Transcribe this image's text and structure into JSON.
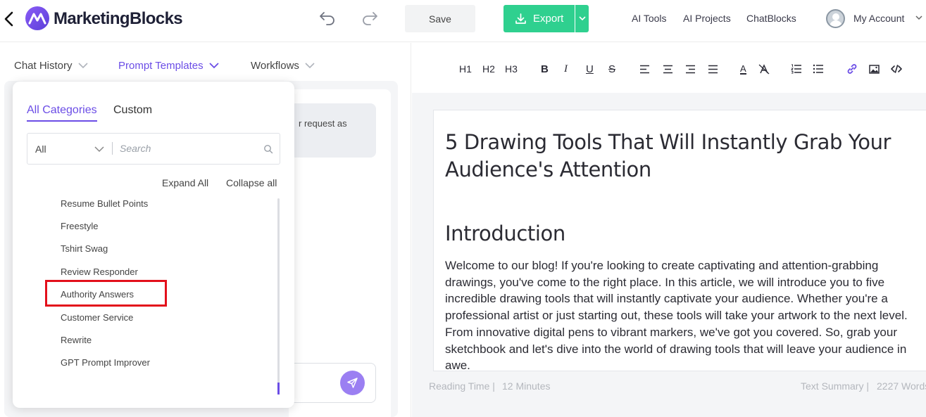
{
  "header": {
    "brand": "MarketingBlocks",
    "save_label": "Save",
    "export_label": "Export",
    "nav": [
      "AI Tools",
      "AI Projects",
      "ChatBlocks"
    ],
    "account_label": "My Account"
  },
  "left_tabs": [
    {
      "label": "Chat History",
      "active": false
    },
    {
      "label": "Prompt Templates",
      "active": true
    },
    {
      "label": "Workflows",
      "active": false
    }
  ],
  "chat": {
    "bubble_text": "r request as"
  },
  "prompt_dropdown": {
    "tabs": [
      {
        "label": "All Categories",
        "active": true
      },
      {
        "label": "Custom",
        "active": false
      }
    ],
    "category_value": "All",
    "search_placeholder": "Search",
    "expand_all": "Expand All",
    "collapse_all": "Collapse all",
    "items": [
      "Resume Bullet Points",
      "Freestyle",
      "Tshirt Swag",
      "Review Responder",
      "Authority Answers",
      "Customer Service",
      "Rewrite",
      "GPT Prompt Improver"
    ],
    "highlighted_item": "Authority Answers"
  },
  "editor": {
    "toolbar": {
      "h1": "H1",
      "h2": "H2",
      "h3": "H3",
      "bold": "B",
      "italic": "I",
      "underline": "U",
      "strike": "S",
      "font_color": "A"
    },
    "title": "5 Drawing Tools That Will Instantly Grab Your Audience's Attention",
    "heading": "Introduction",
    "body": "Welcome to our blog! If you're looking to create captivating and attention-grabbing drawings, you've come to the right place. In this article, we will introduce you to five incredible drawing tools that will instantly captivate your audience. Whether you're a professional artist or just starting out, these tools will take your artwork to the next level. From innovative digital pens to vibrant markers, we've got you covered. So, grab your sketchbook and let's dive into the world of drawing tools that will leave your audience in awe."
  },
  "status_bar": {
    "reading_time_label": "Reading Time |",
    "reading_time_value": "12 Minutes",
    "summary_label": "Text Summary |",
    "summary_value": "2227 Words"
  },
  "colors": {
    "accent": "#6b4de6",
    "export_green": "#2fd08f",
    "highlight_red": "#e3101b",
    "send_purple": "#9b7ff2"
  },
  "icons": {
    "back": "chevron-left-icon",
    "logo": "marketingblocks-logo",
    "undo": "undo-icon",
    "redo": "redo-icon",
    "export": "download-icon",
    "search": "search-icon",
    "send": "paper-plane-icon",
    "avatar": "user-avatar-icon"
  }
}
